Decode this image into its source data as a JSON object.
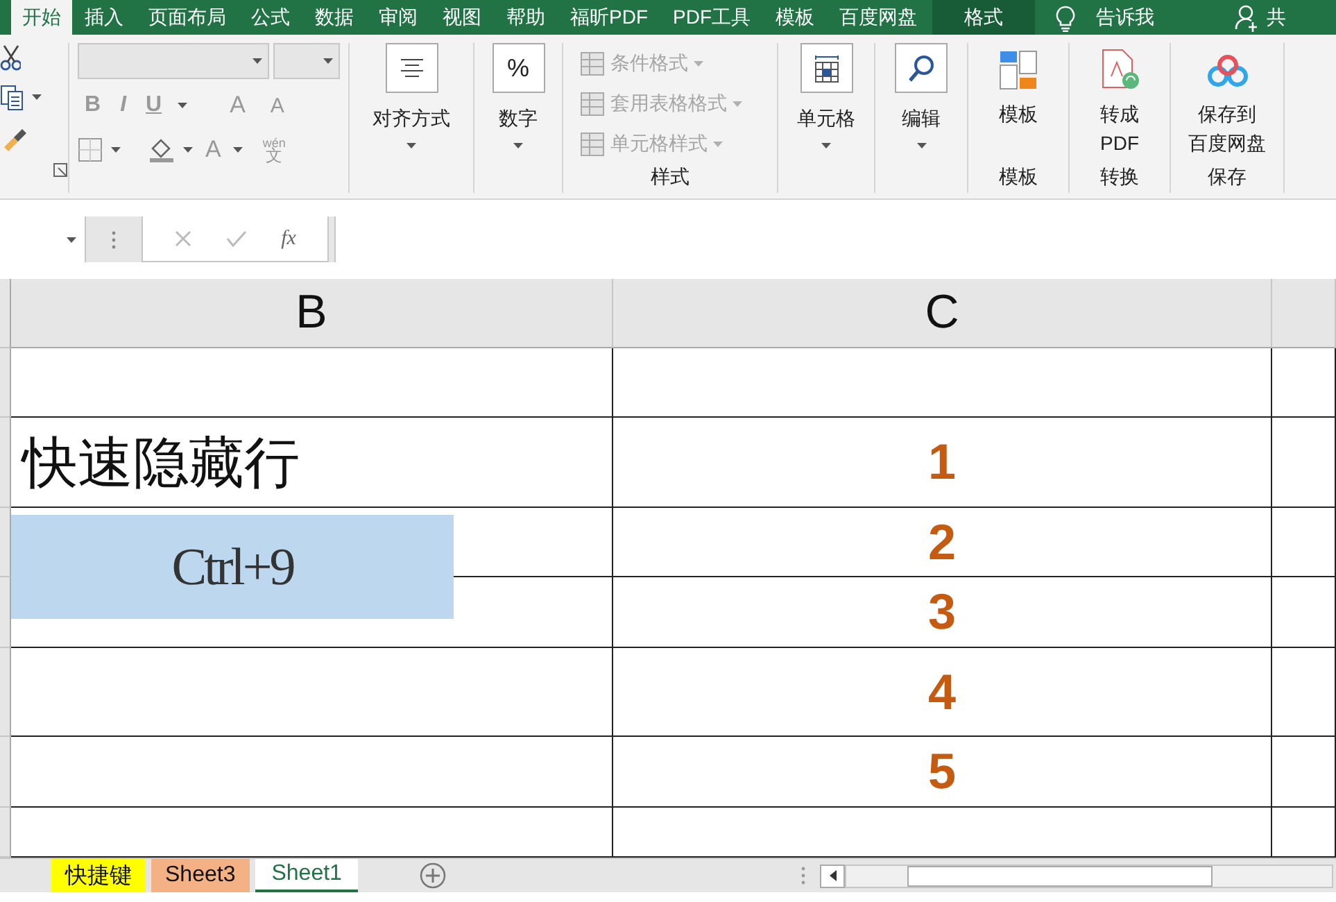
{
  "ribbon_tabs": [
    {
      "label": "开始",
      "selected": true,
      "kind": "normal"
    },
    {
      "label": "插入",
      "selected": false,
      "kind": "normal"
    },
    {
      "label": "页面布局",
      "selected": false,
      "kind": "normal"
    },
    {
      "label": "公式",
      "selected": false,
      "kind": "normal"
    },
    {
      "label": "数据",
      "selected": false,
      "kind": "normal"
    },
    {
      "label": "审阅",
      "selected": false,
      "kind": "normal"
    },
    {
      "label": "视图",
      "selected": false,
      "kind": "normal"
    },
    {
      "label": "帮助",
      "selected": false,
      "kind": "normal"
    },
    {
      "label": "福昕PDF",
      "selected": false,
      "kind": "normal"
    },
    {
      "label": "PDF工具",
      "selected": false,
      "kind": "normal"
    },
    {
      "label": "模板",
      "selected": false,
      "kind": "normal"
    },
    {
      "label": "百度网盘",
      "selected": false,
      "kind": "normal"
    },
    {
      "label": "格式",
      "selected": false,
      "kind": "context"
    }
  ],
  "tell_me": "告诉我",
  "share": "共",
  "font_group": {
    "format_buttons": [
      "B",
      "I",
      "U"
    ],
    "size_buttons": [
      "A",
      "A"
    ],
    "font_color": "A",
    "phonetic_top": "wén",
    "phonetic_char": "文"
  },
  "alignment": {
    "label": "对齐方式"
  },
  "number": {
    "symbol": "%",
    "label": "数字"
  },
  "styles": {
    "items": [
      {
        "label": "条件格式",
        "disabled": true
      },
      {
        "label": "套用表格格式",
        "disabled": true
      },
      {
        "label": "单元格样式",
        "disabled": true
      }
    ],
    "group_label": "样式"
  },
  "cells": {
    "label": "单元格"
  },
  "editing": {
    "label": "编辑"
  },
  "template": {
    "label": "模板",
    "group_label": "模板"
  },
  "convert": {
    "lines": [
      "转成",
      "PDF"
    ],
    "group_label": "转换"
  },
  "save": {
    "lines": [
      "保存到",
      "百度网盘"
    ],
    "group_label": "保存"
  },
  "formula_bar": {
    "fx": "fx"
  },
  "sheet": {
    "columns": [
      "B",
      "C"
    ],
    "rows": [
      {},
      {
        "column_b": "快速隐藏行",
        "column_c": "1"
      },
      {
        "column_c": "2"
      },
      {
        "column_c": "3"
      },
      {
        "column_c": "4"
      },
      {
        "column_c": "5"
      },
      {}
    ],
    "text_box": "Ctrl+9"
  },
  "sheet_tabs": [
    {
      "label": "快捷键",
      "selected": false,
      "color": "#ffff00"
    },
    {
      "label": "Sheet3",
      "selected": false,
      "color": "#f4b183"
    },
    {
      "label": "Sheet1",
      "selected": true
    }
  ]
}
